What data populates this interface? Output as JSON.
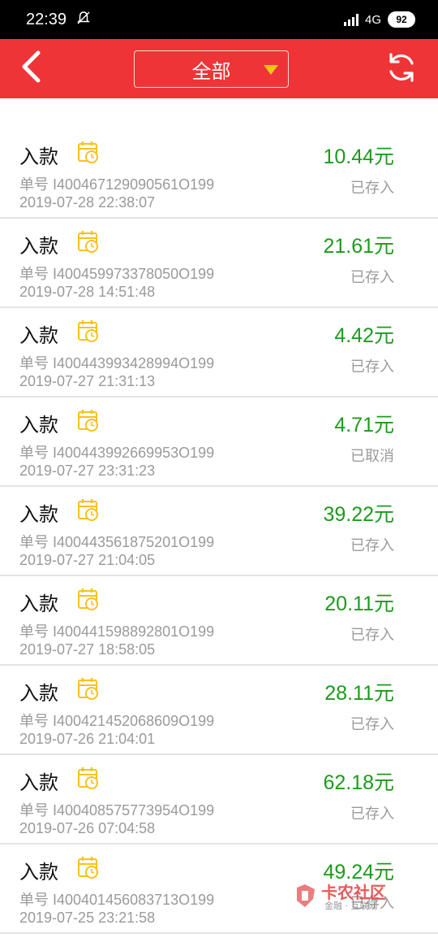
{
  "status_bar": {
    "time": "22:39",
    "network": "4G",
    "battery": "92"
  },
  "header": {
    "filter_label": "全部",
    "accent": "#ef3437",
    "arrow_color": "#f7c21a"
  },
  "transactions": [
    {
      "title": "入款",
      "order": "单号 I400467129090561O199",
      "time": "2019-07-28 22:38:07",
      "amount": "10.44元",
      "status": "已存入"
    },
    {
      "title": "入款",
      "order": "单号 I400459973378050O199",
      "time": "2019-07-28 14:51:48",
      "amount": "21.61元",
      "status": "已存入"
    },
    {
      "title": "入款",
      "order": "单号 I400443993428994O199",
      "time": "2019-07-27 21:31:13",
      "amount": "4.42元",
      "status": "已存入"
    },
    {
      "title": "入款",
      "order": "单号 I400443992669953O199",
      "time": "2019-07-27 23:31:23",
      "amount": "4.71元",
      "status": "已取消"
    },
    {
      "title": "入款",
      "order": "单号 I400443561875201O199",
      "time": "2019-07-27 21:04:05",
      "amount": "39.22元",
      "status": "已存入"
    },
    {
      "title": "入款",
      "order": "单号 I400441598892801O199",
      "time": "2019-07-27 18:58:05",
      "amount": "20.11元",
      "status": "已存入"
    },
    {
      "title": "入款",
      "order": "单号 I400421452068609O199",
      "time": "2019-07-26 21:04:01",
      "amount": "28.11元",
      "status": "已存入"
    },
    {
      "title": "入款",
      "order": "单号 I400408575773954O199",
      "time": "2019-07-26 07:04:58",
      "amount": "62.18元",
      "status": "已存入"
    },
    {
      "title": "入款",
      "order": "单号 I400401456083713O199",
      "time": "2019-07-25 23:21:58",
      "amount": "49.24元",
      "status": "已存入"
    }
  ],
  "watermark": {
    "title": "卡农社区",
    "subtitle": "金融 · 互联网"
  },
  "colors": {
    "amount": "#1c9b1c",
    "calendar": "#f7c21a",
    "muted": "#9a9a9a"
  }
}
